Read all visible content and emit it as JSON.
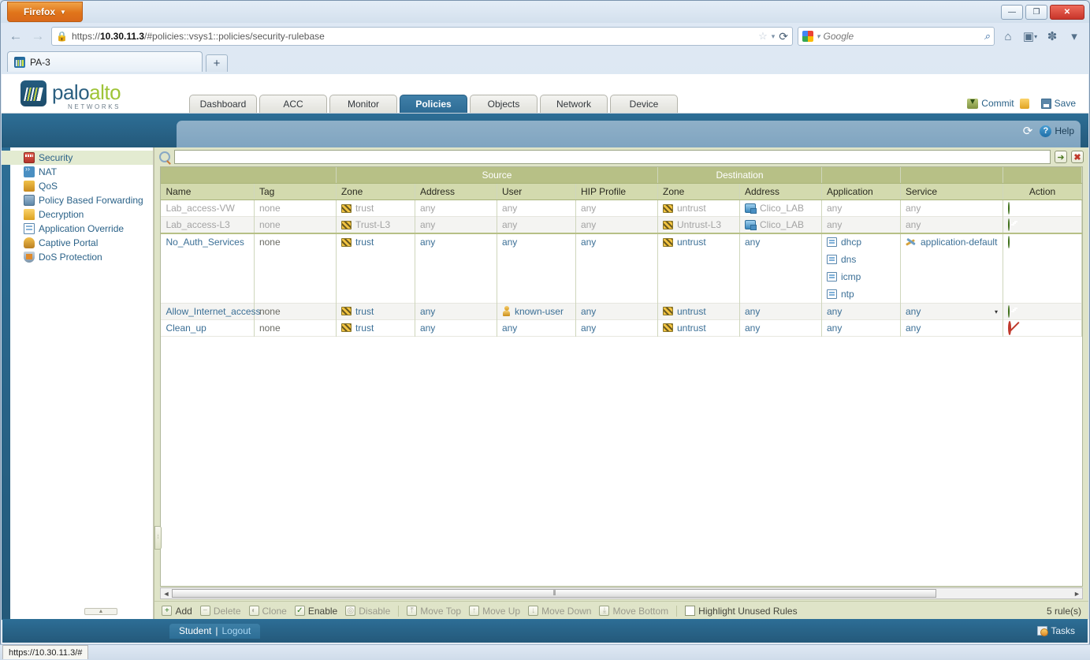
{
  "browser": {
    "menu_button": "Firefox",
    "menu_caret": "▼",
    "back_icon": "←",
    "forward_icon": "→",
    "lock_icon": "🔒",
    "url_prefix": "https://",
    "url_host": "10.30.11.3",
    "url_path": "/#policies::vsys1::policies/security-rulebase",
    "url_full": "https://10.30.11.3/#policies::vsys1::policies/security-rulebase",
    "star_icon": "☆",
    "caret_icon": "▾",
    "reload_icon": "⟳",
    "search_placeholder": "Google",
    "search_mag_icon": "⌕",
    "home_icon": "⌂",
    "bookmarks_icon": "▣",
    "addons_icon": "✽",
    "overflow_icon": "▾",
    "tab_title": "PA-3",
    "new_tab_label": "+",
    "minimize_label": "—",
    "maximize_label": "❐",
    "close_label": "✕"
  },
  "header": {
    "logo_palo": "palo",
    "logo_alto": "alto",
    "logo_networks": "NETWORKS",
    "tabs": [
      {
        "label": "Dashboard",
        "active": false
      },
      {
        "label": "ACC",
        "active": false
      },
      {
        "label": "Monitor",
        "active": false
      },
      {
        "label": "Policies",
        "active": true
      },
      {
        "label": "Objects",
        "active": false
      },
      {
        "label": "Network",
        "active": false
      },
      {
        "label": "Device",
        "active": false
      }
    ],
    "commit_label": "Commit",
    "save_label": "Save",
    "refresh_icon": "⟳",
    "help_label": "Help",
    "help_badge": "?"
  },
  "sidebar": {
    "items": [
      {
        "label": "Security",
        "icon": "security-icon",
        "active": true
      },
      {
        "label": "NAT",
        "icon": "nat-icon",
        "active": false
      },
      {
        "label": "QoS",
        "icon": "qos-icon",
        "active": false
      },
      {
        "label": "Policy Based Forwarding",
        "icon": "pbf-icon",
        "active": false
      },
      {
        "label": "Decryption",
        "icon": "decryption-icon",
        "active": false
      },
      {
        "label": "Application Override",
        "icon": "application-override-icon",
        "active": false
      },
      {
        "label": "Captive Portal",
        "icon": "captive-portal-icon",
        "active": false
      },
      {
        "label": "DoS Protection",
        "icon": "dos-protection-icon",
        "active": false
      }
    ],
    "collapse_label": "▲"
  },
  "filter": {
    "value": "",
    "placeholder": "",
    "search_icon": "search-icon",
    "apply_icon": "➜",
    "clear_icon": "✖"
  },
  "table": {
    "group_headers": [
      {
        "label": "",
        "span": 2
      },
      {
        "label": "Source",
        "span": 4
      },
      {
        "label": "Destination",
        "span": 2
      },
      {
        "label": "",
        "span": 1
      },
      {
        "label": "",
        "span": 1
      },
      {
        "label": "",
        "span": 1
      }
    ],
    "columns": [
      "Name",
      "Tag",
      "Zone",
      "Address",
      "User",
      "HIP Profile",
      "Zone",
      "Address",
      "Application",
      "Service",
      "Action"
    ],
    "rows": [
      {
        "name": "Lab_access-VW",
        "tag": "none",
        "src_zone": "trust",
        "src_address": "any",
        "user": "any",
        "hip_profile": "any",
        "dst_zone": "untrust",
        "dst_address": "Clico_LAB",
        "application": "any",
        "service": "any",
        "action": "allow",
        "disabled": true,
        "user_icon": false,
        "dst_address_icon": true,
        "service_icon": false
      },
      {
        "name": "Lab_access-L3",
        "tag": "none",
        "src_zone": "Trust-L3",
        "src_address": "any",
        "user": "any",
        "hip_profile": "any",
        "dst_zone": "Untrust-L3",
        "dst_address": "Clico_LAB",
        "application": "any",
        "service": "any",
        "action": "allow",
        "disabled": true,
        "user_icon": false,
        "dst_address_icon": true,
        "service_icon": false
      },
      {
        "name": "No_Auth_Services",
        "tag": "none",
        "src_zone": "trust",
        "src_address": "any",
        "user": "any",
        "hip_profile": "any",
        "dst_zone": "untrust",
        "dst_address": "any",
        "applications": [
          "dhcp",
          "dns",
          "icmp",
          "ntp"
        ],
        "service": "application-default",
        "action": "allow",
        "disabled": false,
        "user_icon": false,
        "dst_address_icon": false,
        "service_icon": true
      },
      {
        "name": "Allow_Internet_access",
        "tag": "none",
        "src_zone": "trust",
        "src_address": "any",
        "user": "known-user",
        "hip_profile": "any",
        "dst_zone": "untrust",
        "dst_address": "any",
        "application": "any",
        "service": "any",
        "action": "allow",
        "disabled": false,
        "user_icon": true,
        "dst_address_icon": false,
        "service_icon": false,
        "service_caret": "▾"
      },
      {
        "name": "Clean_up",
        "tag": "none",
        "src_zone": "trust",
        "src_address": "any",
        "user": "any",
        "hip_profile": "any",
        "dst_zone": "untrust",
        "dst_address": "any",
        "application": "any",
        "service": "any",
        "action": "deny",
        "disabled": false,
        "user_icon": false,
        "dst_address_icon": false,
        "service_icon": false
      }
    ]
  },
  "scrollbar": {
    "left_arrow": "◄",
    "right_arrow": "►",
    "grip": "⦀"
  },
  "actionbar": {
    "buttons": [
      {
        "label": "Add",
        "glyph": "+",
        "state": "on"
      },
      {
        "label": "Delete",
        "glyph": "−",
        "state": "dim"
      },
      {
        "label": "Clone",
        "glyph": "◐",
        "state": "dim"
      },
      {
        "label": "Enable",
        "glyph": "✓",
        "state": "on"
      },
      {
        "label": "Disable",
        "glyph": "◎",
        "state": "dim"
      }
    ],
    "move_buttons": [
      {
        "label": "Move Top",
        "glyph": "⤒",
        "state": "dim"
      },
      {
        "label": "Move Up",
        "glyph": "↑",
        "state": "dim"
      },
      {
        "label": "Move Down",
        "glyph": "↓",
        "state": "dim"
      },
      {
        "label": "Move Bottom",
        "glyph": "⤓",
        "state": "dim"
      }
    ],
    "highlight_label": "Highlight Unused Rules",
    "highlight_checked": false,
    "rule_count": "5 rule(s)"
  },
  "footer": {
    "user": "Student",
    "separator": "|",
    "logout": "Logout",
    "tasks_label": "Tasks"
  },
  "statusbar": {
    "tip": "https://10.30.11.3/#"
  },
  "colors": {
    "brand_blue": "#2d6e96",
    "brand_green": "#9ec437",
    "table_header": "#b7c086",
    "table_subheader": "#d3daae",
    "panel_bg": "#dfe4c8",
    "link": "#2b6288",
    "allow": "#4e8a1e",
    "deny": "#c0392b",
    "firefox_orange": "#e0741a"
  }
}
